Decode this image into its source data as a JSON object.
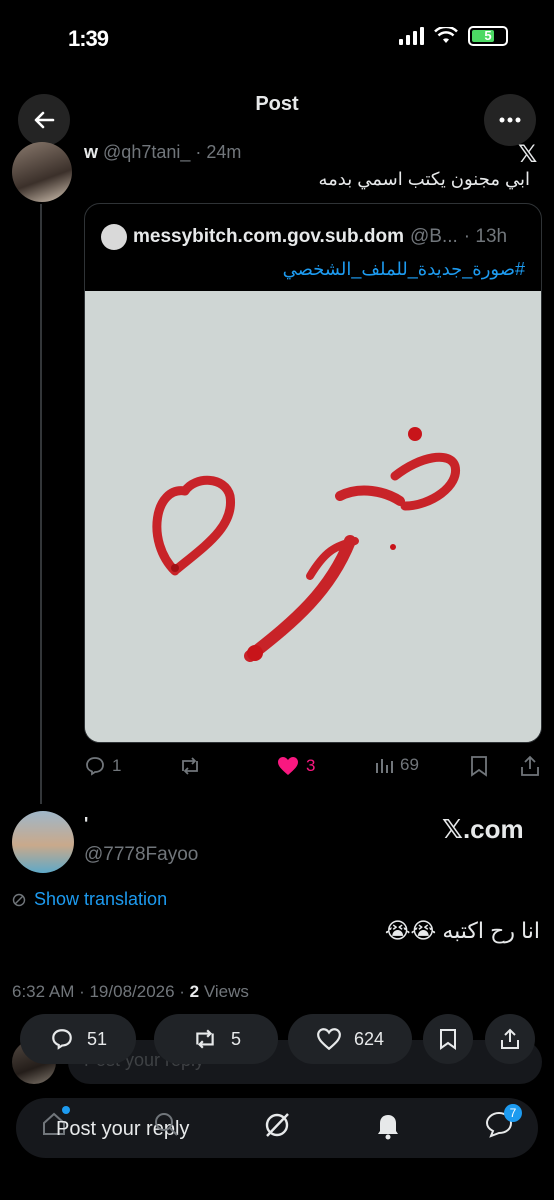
{
  "status_bar": {
    "time": "1:39",
    "battery": "5"
  },
  "header": {
    "title": "Post"
  },
  "tweet1": {
    "name": "w",
    "handle": "@qh7tani_",
    "time": "· 24m",
    "text": "ابي مجنون يكتب اسمي بدمه",
    "quote": {
      "name": "messybitch.com.gov.sub.dom",
      "handle": "@B...",
      "time": "· 13h",
      "hashtag": "#صورة_جديدة_للملف_الشخصي"
    },
    "actions": {
      "replies": "1",
      "likes": "3",
      "views": "69"
    }
  },
  "tweet2": {
    "name": "'",
    "handle": "@7778Fayoo",
    "watermark": "𝕏.com",
    "show_translation": "Show translation",
    "text": "انا رح اكتبه 😭😭",
    "timestamp": "6:32 AM · 19/08/2026 · ",
    "views_count": "2",
    "views_label": " Views"
  },
  "bottom_actions": {
    "replies": "51",
    "retweets": "5",
    "likes": "624"
  },
  "reply_bar": {
    "placeholder": "Post your reply"
  },
  "nav": {
    "messages_badge": "7"
  },
  "colors": {
    "accent": "#1d9bf0",
    "like": "#f91880",
    "background": "#000000"
  }
}
